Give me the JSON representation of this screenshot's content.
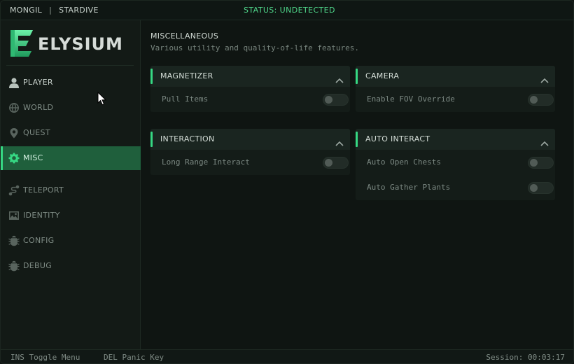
{
  "topbar": {
    "user": "MONGIL",
    "separator": "|",
    "game": "STARDIVE",
    "status": "STATUS: UNDETECTED"
  },
  "logo": {
    "text": "ELYSIUM",
    "icon": "elysium-e-logo"
  },
  "sidebar": {
    "items": [
      {
        "label": "PLAYER",
        "icon": "user-icon"
      },
      {
        "label": "WORLD",
        "icon": "globe-icon"
      },
      {
        "label": "QUEST",
        "icon": "map-pin-icon"
      },
      {
        "label": "MISC",
        "icon": "gear-icon",
        "active": true
      },
      {
        "label": "TELEPORT",
        "icon": "route-icon"
      },
      {
        "label": "IDENTITY",
        "icon": "image-icon"
      },
      {
        "label": "CONFIG",
        "icon": "bug-icon"
      },
      {
        "label": "DEBUG",
        "icon": "bug-icon"
      }
    ]
  },
  "page": {
    "title": "MISCELLANEOUS",
    "subtitle": "Various utility and quality-of-life features."
  },
  "cards": {
    "magnetizer": {
      "title": "MAGNETIZER",
      "rows": [
        {
          "label": "Pull Items",
          "enabled": false
        }
      ]
    },
    "camera": {
      "title": "CAMERA",
      "rows": [
        {
          "label": "Enable FOV Override",
          "enabled": false
        }
      ]
    },
    "interaction": {
      "title": "INTERACTION",
      "rows": [
        {
          "label": "Long Range Interact",
          "enabled": false
        }
      ]
    },
    "auto_interact": {
      "title": "AUTO INTERACT",
      "rows": [
        {
          "label": "Auto Open Chests",
          "enabled": false
        },
        {
          "label": "Auto Gather Plants",
          "enabled": false
        }
      ]
    }
  },
  "footer": {
    "toggle_hint": "INS Toggle Menu",
    "panic_hint": "DEL Panic Key",
    "session": "Session: 00:03:17"
  },
  "colors": {
    "accent": "#36d883",
    "status": "#4fd68a",
    "active_bg": "#1f5f3c"
  }
}
